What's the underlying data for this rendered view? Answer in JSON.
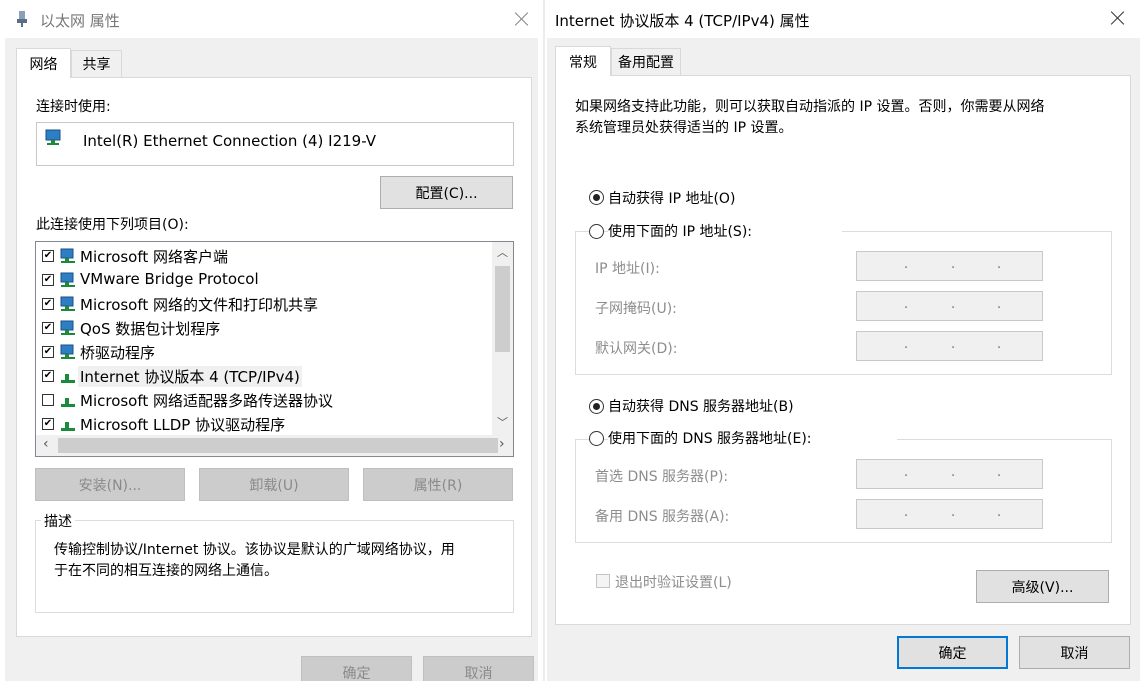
{
  "left_dialog": {
    "title": "以太网 属性",
    "tabs": [
      "网络",
      "共享"
    ],
    "connect_using_label": "连接时使用:",
    "adapter_name": "Intel(R) Ethernet Connection (4) I219-V",
    "configure_button": "配置(C)...",
    "items_label": "此连接使用下列项目(O):",
    "items": [
      {
        "checked": true,
        "label": "Microsoft 网络客户端",
        "icon": "network-computer-icon"
      },
      {
        "checked": true,
        "label": "VMware Bridge Protocol",
        "icon": "network-computer-icon"
      },
      {
        "checked": true,
        "label": "Microsoft 网络的文件和打印机共享",
        "icon": "network-computer-icon"
      },
      {
        "checked": true,
        "label": "QoS 数据包计划程序",
        "icon": "network-computer-icon"
      },
      {
        "checked": true,
        "label": "桥驱动程序",
        "icon": "network-computer-icon"
      },
      {
        "checked": true,
        "label": "Internet 协议版本 4 (TCP/IPv4)",
        "icon": "protocol-icon",
        "selected": true
      },
      {
        "checked": false,
        "label": "Microsoft 网络适配器多路传送器协议",
        "icon": "protocol-icon"
      },
      {
        "checked": true,
        "label": "Microsoft LLDP 协议驱动程序",
        "icon": "protocol-icon"
      }
    ],
    "install_button": "安装(N)...",
    "uninstall_button": "卸载(U)",
    "properties_button": "属性(R)",
    "description_label": "描述",
    "description_text_line1": "传输控制协议/Internet 协议。该协议是默认的广域网络协议，用",
    "description_text_line2": "于在不同的相互连接的网络上通信。",
    "ok_button": "确定",
    "cancel_button": "取消"
  },
  "right_dialog": {
    "title": "Internet 协议版本 4 (TCP/IPv4) 属性",
    "tabs": [
      "常规",
      "备用配置"
    ],
    "intro_line1": "如果网络支持此功能，则可以获取自动指派的 IP 设置。否则，你需要从网络",
    "intro_line2": "系统管理员处获得适当的 IP 设置。",
    "radio_auto_ip": "自动获得 IP 地址(O)",
    "radio_manual_ip": "使用下面的 IP 地址(S):",
    "ip_address_label": "IP 地址(I):",
    "subnet_mask_label": "子网掩码(U):",
    "default_gateway_label": "默认网关(D):",
    "radio_auto_dns": "自动获得 DNS 服务器地址(B)",
    "radio_manual_dns": "使用下面的 DNS 服务器地址(E):",
    "preferred_dns_label": "首选 DNS 服务器(P):",
    "alternate_dns_label": "备用 DNS 服务器(A):",
    "validate_on_exit_label": "退出时验证设置(L)",
    "advanced_button": "高级(V)...",
    "ok_button": "确定",
    "cancel_button": "取消",
    "ip_dot": "."
  }
}
